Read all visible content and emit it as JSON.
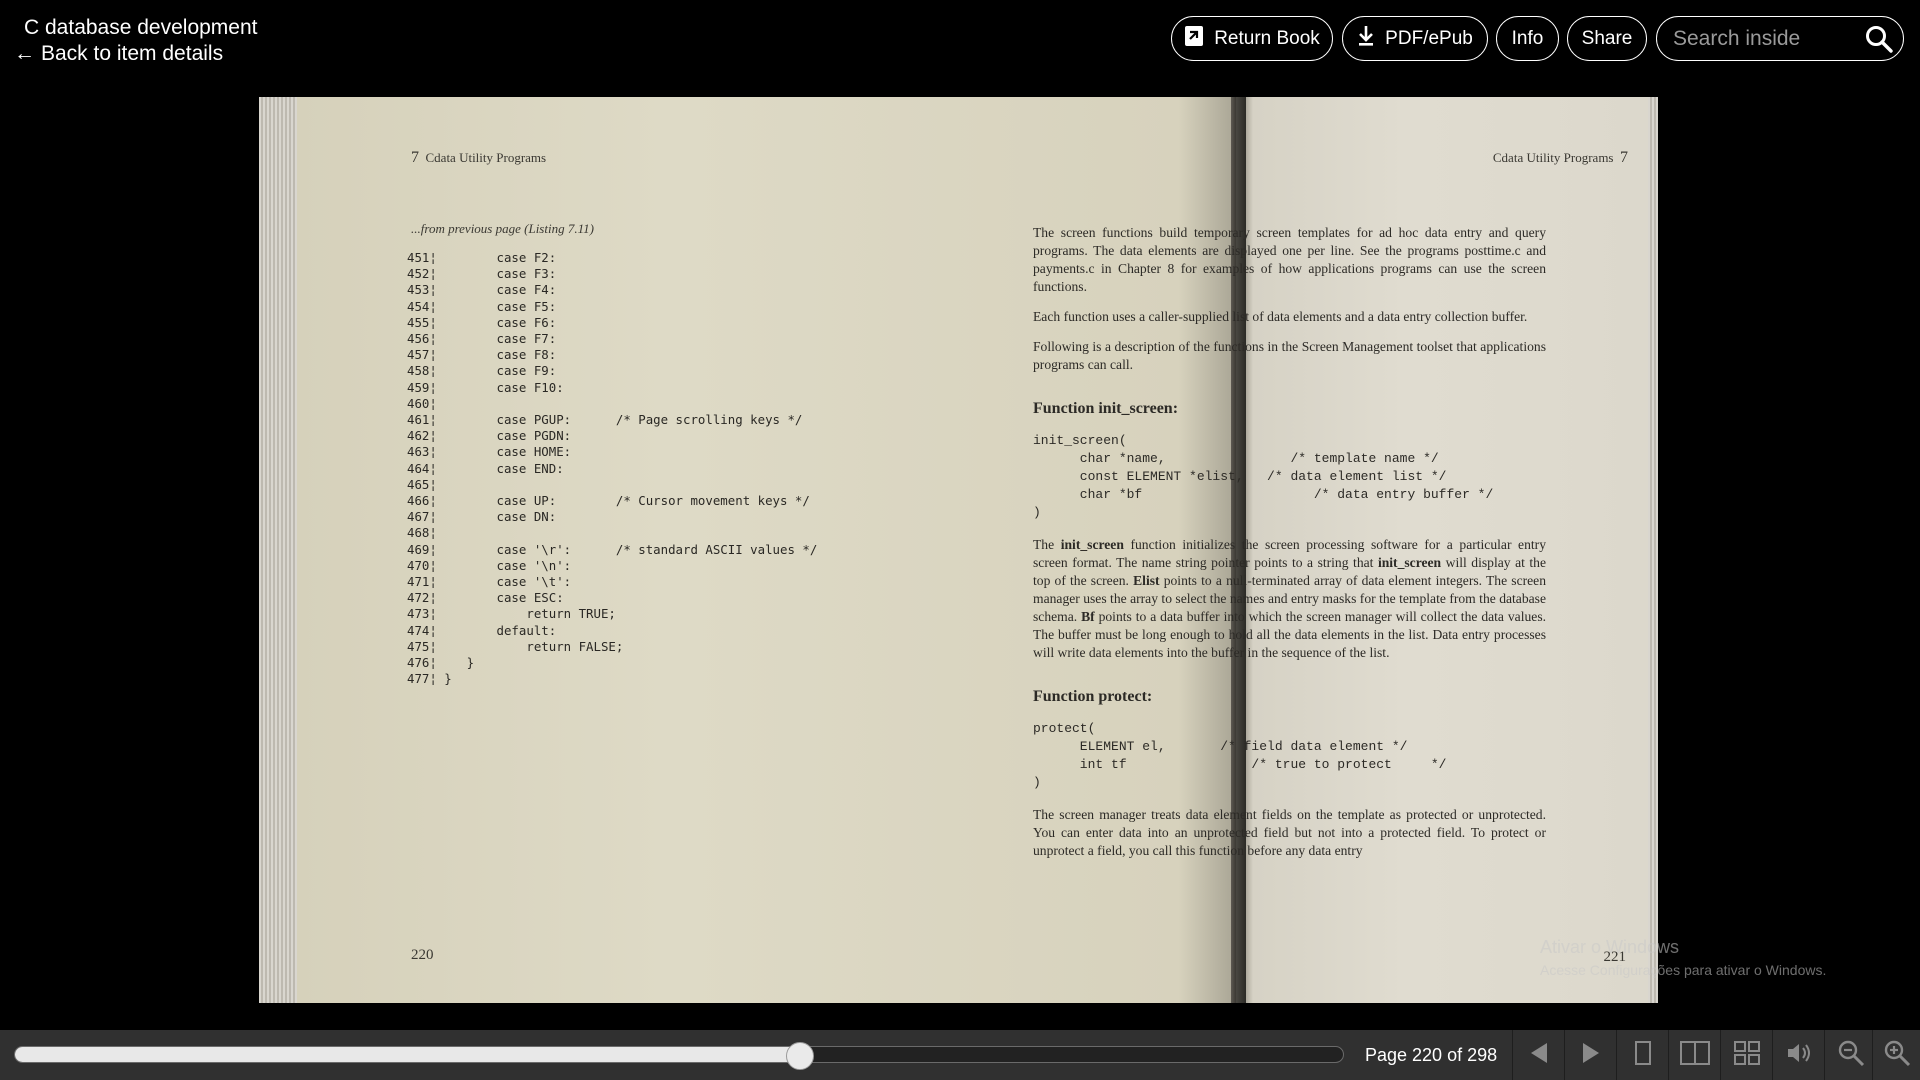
{
  "header": {
    "book_title": "C database development",
    "back_label": "Back to item details",
    "return_label": "Return Book",
    "pdf_label": "PDF/ePub",
    "info_label": "Info",
    "share_label": "Share",
    "search_placeholder": "Search inside"
  },
  "left_page": {
    "chapter_number": "7",
    "running_head": "Cdata Utility Programs",
    "from_previous": "...from previous page (Listing 7.11)",
    "code_lines": [
      "451¦        case F2:",
      "452¦        case F3:",
      "453¦        case F4:",
      "454¦        case F5:",
      "455¦        case F6:",
      "456¦        case F7:",
      "457¦        case F8:",
      "458¦        case F9:",
      "459¦        case F10:",
      "460¦",
      "461¦        case PGUP:      /* Page scrolling keys */",
      "462¦        case PGDN:",
      "463¦        case HOME:",
      "464¦        case END:",
      "465¦",
      "466¦        case UP:        /* Cursor movement keys */",
      "467¦        case DN:",
      "468¦",
      "469¦        case '\\r':      /* standard ASCII values */",
      "470¦        case '\\n':",
      "471¦        case '\\t':",
      "472¦        case ESC:",
      "473¦            return TRUE;",
      "474¦        default:",
      "475¦            return FALSE;",
      "476¦    }",
      "477¦ }"
    ],
    "page_number": "220"
  },
  "right_page": {
    "running_head": "Cdata Utility Programs",
    "chapter_number": "7",
    "p1": "The screen functions build temporary screen templates for ad hoc data entry and query programs. The data elements are displayed one per line. See the programs posttime.c and payments.c in Chapter 8 for examples of how applications programs can use the screen functions.",
    "p2": "Each function uses a caller-supplied list of data elements and a data entry collection buffer.",
    "p3": "Following is a description of the functions in the Screen Management toolset that applications programs can call.",
    "h1": "Function init_screen:",
    "code1": "init_screen(\n      char *name,                /* template name */\n      const ELEMENT *elist,   /* data element list */\n      char *bf                      /* data entry buffer */\n)",
    "p4_pre": "The ",
    "p4_b1": "init_screen",
    "p4_t1": " function initializes the screen processing software for a particular entry screen format. The name string pointer points to a string that ",
    "p4_b2": "init_screen",
    "p4_t2": " will display at the top of the screen. ",
    "p4_b3": "Elist",
    "p4_t3": " points to a null-terminated array of data element integers. The screen manager uses the array to select the names and entry masks for the template from the database schema. ",
    "p4_b4": "Bf",
    "p4_t4": " points to a data buffer into which the screen manager will collect the data values. The buffer must be long enough to hold all the data elements in the list. Data entry processes will write data elements into the buffer in the sequence of the list.",
    "h2": "Function protect:",
    "code2": "protect(\n      ELEMENT el,       /* field data element */\n      int tf                /* true to protect     */\n)",
    "p5": "The screen manager treats data element fields on the template as protected or unprotected. You can enter data into an unprotected field but not into a protected field. To protect or unprotect a field, you call this function before any data entry",
    "page_number": "221"
  },
  "watermark": {
    "title": "Ativar o Windows",
    "subtitle": "Acesse Configurações para ativar o Windows."
  },
  "footer": {
    "page_label": "Page 220 of 298",
    "current_page": 220,
    "total_pages": 298,
    "progress_fraction": 0.591
  },
  "icons": {
    "return": "return-book-icon",
    "download": "download-icon",
    "search": "search-icon",
    "prev": "prev-page-icon",
    "next": "next-page-icon",
    "one_page": "one-page-view-icon",
    "two_page": "two-page-view-icon",
    "thumbnails": "thumbnail-view-icon",
    "audio": "read-aloud-icon",
    "zoom_out": "zoom-out-icon",
    "zoom_in": "zoom-in-icon"
  }
}
